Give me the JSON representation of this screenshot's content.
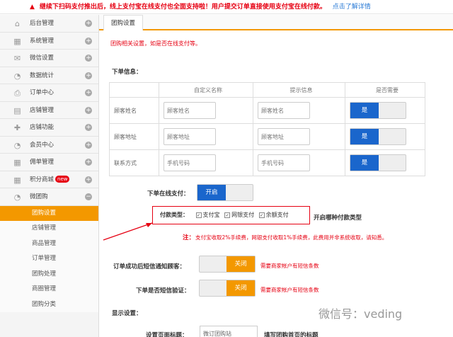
{
  "notice": {
    "message": "继续下扫码支付推出后，线上支付宝在线支付也全面支持啦！用户提交订单直接使用支付宝在线付款。",
    "link": "点击了解详情"
  },
  "sidebar": {
    "items": [
      {
        "label": "后台管理",
        "icon": "home-icon"
      },
      {
        "label": "系统管理",
        "icon": "grid-icon"
      },
      {
        "label": "微信设置",
        "icon": "mail-icon"
      },
      {
        "label": "数据统计",
        "icon": "pie-icon"
      },
      {
        "label": "订单中心",
        "icon": "printer-icon"
      },
      {
        "label": "店铺管理",
        "icon": "store-icon"
      },
      {
        "label": "店铺功能",
        "icon": "plus-icon"
      },
      {
        "label": "会员中心",
        "icon": "pie-icon"
      },
      {
        "label": "佣单管理",
        "icon": "grid-icon"
      },
      {
        "label": "积分商城",
        "icon": "grid-icon",
        "badge": "new"
      },
      {
        "label": "微团购",
        "icon": "pie-icon"
      }
    ],
    "sub_items": [
      "团购设置",
      "店铺管理",
      "商品管理",
      "订单管理",
      "团购处理",
      "商圈管理",
      "团购分类"
    ],
    "active_sub": "团购设置"
  },
  "main": {
    "tab": "团购设置",
    "hint": "团购相关设置，如是否在线支付等。",
    "order_info_title": "下单信息：",
    "table": {
      "headers": [
        "",
        "自定义名称",
        "提示信息",
        "是否需要"
      ],
      "rows": [
        {
          "field": "顾客姓名",
          "name": "顾客姓名",
          "tip": "顾客姓名",
          "required": "是"
        },
        {
          "field": "顾客地址",
          "name": "顾客地址",
          "tip": "顾客地址",
          "required": "是"
        },
        {
          "field": "联系方式",
          "name": "手机号码",
          "tip": "手机号码",
          "required": "是"
        }
      ]
    },
    "online_pay": {
      "label": "下单在线支付：",
      "state": "开启"
    },
    "pay_types": {
      "label": "付款类型：",
      "options": [
        "支付宝",
        "网银支付",
        "余额支付"
      ],
      "note": "开启哪种付款类型"
    },
    "fee_note_label": "注：",
    "fee_note": "支付宝收取2%手续费，网银支付收取1%手续费，此费用并非系统收取，请知悉。",
    "sms_notify": {
      "label": "订单成功后短信通知顾客：",
      "state": "关闭",
      "note": "需要商家帐户有短信条数"
    },
    "sms_verify": {
      "label": "下单是否短信验证：",
      "state": "关闭",
      "note": "需要商家帐户有短信条数"
    },
    "display_title": "显示设置：",
    "page_title": {
      "label": "设置页面标题：",
      "value": "微订团购站",
      "note": "填写团购首页的标题"
    },
    "watermark": "微信号：veding"
  }
}
